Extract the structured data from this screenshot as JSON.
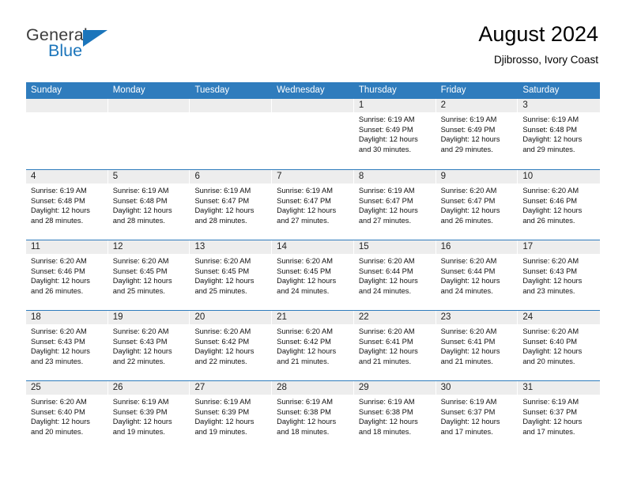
{
  "logo": {
    "word_top": "General",
    "word_bottom": "Blue",
    "accent_color": "#1b75bb",
    "text_color": "#3c3c3c",
    "triangle_icon": "triangle-icon"
  },
  "header": {
    "title": "August 2024",
    "subtitle": "Djibrosso, Ivory Coast"
  },
  "colors": {
    "header_blue": "#2f7cbd",
    "day_strip_gray": "#ededed",
    "text": "#000000"
  },
  "weekdays": [
    "Sunday",
    "Monday",
    "Tuesday",
    "Wednesday",
    "Thursday",
    "Friday",
    "Saturday"
  ],
  "weeks": [
    [
      {
        "day": "",
        "empty": true
      },
      {
        "day": "",
        "empty": true
      },
      {
        "day": "",
        "empty": true
      },
      {
        "day": "",
        "empty": true
      },
      {
        "day": "1",
        "sunrise": "Sunrise: 6:19 AM",
        "sunset": "Sunset: 6:49 PM",
        "daylight_1": "Daylight: 12 hours",
        "daylight_2": "and 30 minutes."
      },
      {
        "day": "2",
        "sunrise": "Sunrise: 6:19 AM",
        "sunset": "Sunset: 6:49 PM",
        "daylight_1": "Daylight: 12 hours",
        "daylight_2": "and 29 minutes."
      },
      {
        "day": "3",
        "sunrise": "Sunrise: 6:19 AM",
        "sunset": "Sunset: 6:48 PM",
        "daylight_1": "Daylight: 12 hours",
        "daylight_2": "and 29 minutes."
      }
    ],
    [
      {
        "day": "4",
        "sunrise": "Sunrise: 6:19 AM",
        "sunset": "Sunset: 6:48 PM",
        "daylight_1": "Daylight: 12 hours",
        "daylight_2": "and 28 minutes."
      },
      {
        "day": "5",
        "sunrise": "Sunrise: 6:19 AM",
        "sunset": "Sunset: 6:48 PM",
        "daylight_1": "Daylight: 12 hours",
        "daylight_2": "and 28 minutes."
      },
      {
        "day": "6",
        "sunrise": "Sunrise: 6:19 AM",
        "sunset": "Sunset: 6:47 PM",
        "daylight_1": "Daylight: 12 hours",
        "daylight_2": "and 28 minutes."
      },
      {
        "day": "7",
        "sunrise": "Sunrise: 6:19 AM",
        "sunset": "Sunset: 6:47 PM",
        "daylight_1": "Daylight: 12 hours",
        "daylight_2": "and 27 minutes."
      },
      {
        "day": "8",
        "sunrise": "Sunrise: 6:19 AM",
        "sunset": "Sunset: 6:47 PM",
        "daylight_1": "Daylight: 12 hours",
        "daylight_2": "and 27 minutes."
      },
      {
        "day": "9",
        "sunrise": "Sunrise: 6:20 AM",
        "sunset": "Sunset: 6:47 PM",
        "daylight_1": "Daylight: 12 hours",
        "daylight_2": "and 26 minutes."
      },
      {
        "day": "10",
        "sunrise": "Sunrise: 6:20 AM",
        "sunset": "Sunset: 6:46 PM",
        "daylight_1": "Daylight: 12 hours",
        "daylight_2": "and 26 minutes."
      }
    ],
    [
      {
        "day": "11",
        "sunrise": "Sunrise: 6:20 AM",
        "sunset": "Sunset: 6:46 PM",
        "daylight_1": "Daylight: 12 hours",
        "daylight_2": "and 26 minutes."
      },
      {
        "day": "12",
        "sunrise": "Sunrise: 6:20 AM",
        "sunset": "Sunset: 6:45 PM",
        "daylight_1": "Daylight: 12 hours",
        "daylight_2": "and 25 minutes."
      },
      {
        "day": "13",
        "sunrise": "Sunrise: 6:20 AM",
        "sunset": "Sunset: 6:45 PM",
        "daylight_1": "Daylight: 12 hours",
        "daylight_2": "and 25 minutes."
      },
      {
        "day": "14",
        "sunrise": "Sunrise: 6:20 AM",
        "sunset": "Sunset: 6:45 PM",
        "daylight_1": "Daylight: 12 hours",
        "daylight_2": "and 24 minutes."
      },
      {
        "day": "15",
        "sunrise": "Sunrise: 6:20 AM",
        "sunset": "Sunset: 6:44 PM",
        "daylight_1": "Daylight: 12 hours",
        "daylight_2": "and 24 minutes."
      },
      {
        "day": "16",
        "sunrise": "Sunrise: 6:20 AM",
        "sunset": "Sunset: 6:44 PM",
        "daylight_1": "Daylight: 12 hours",
        "daylight_2": "and 24 minutes."
      },
      {
        "day": "17",
        "sunrise": "Sunrise: 6:20 AM",
        "sunset": "Sunset: 6:43 PM",
        "daylight_1": "Daylight: 12 hours",
        "daylight_2": "and 23 minutes."
      }
    ],
    [
      {
        "day": "18",
        "sunrise": "Sunrise: 6:20 AM",
        "sunset": "Sunset: 6:43 PM",
        "daylight_1": "Daylight: 12 hours",
        "daylight_2": "and 23 minutes."
      },
      {
        "day": "19",
        "sunrise": "Sunrise: 6:20 AM",
        "sunset": "Sunset: 6:43 PM",
        "daylight_1": "Daylight: 12 hours",
        "daylight_2": "and 22 minutes."
      },
      {
        "day": "20",
        "sunrise": "Sunrise: 6:20 AM",
        "sunset": "Sunset: 6:42 PM",
        "daylight_1": "Daylight: 12 hours",
        "daylight_2": "and 22 minutes."
      },
      {
        "day": "21",
        "sunrise": "Sunrise: 6:20 AM",
        "sunset": "Sunset: 6:42 PM",
        "daylight_1": "Daylight: 12 hours",
        "daylight_2": "and 21 minutes."
      },
      {
        "day": "22",
        "sunrise": "Sunrise: 6:20 AM",
        "sunset": "Sunset: 6:41 PM",
        "daylight_1": "Daylight: 12 hours",
        "daylight_2": "and 21 minutes."
      },
      {
        "day": "23",
        "sunrise": "Sunrise: 6:20 AM",
        "sunset": "Sunset: 6:41 PM",
        "daylight_1": "Daylight: 12 hours",
        "daylight_2": "and 21 minutes."
      },
      {
        "day": "24",
        "sunrise": "Sunrise: 6:20 AM",
        "sunset": "Sunset: 6:40 PM",
        "daylight_1": "Daylight: 12 hours",
        "daylight_2": "and 20 minutes."
      }
    ],
    [
      {
        "day": "25",
        "sunrise": "Sunrise: 6:20 AM",
        "sunset": "Sunset: 6:40 PM",
        "daylight_1": "Daylight: 12 hours",
        "daylight_2": "and 20 minutes."
      },
      {
        "day": "26",
        "sunrise": "Sunrise: 6:19 AM",
        "sunset": "Sunset: 6:39 PM",
        "daylight_1": "Daylight: 12 hours",
        "daylight_2": "and 19 minutes."
      },
      {
        "day": "27",
        "sunrise": "Sunrise: 6:19 AM",
        "sunset": "Sunset: 6:39 PM",
        "daylight_1": "Daylight: 12 hours",
        "daylight_2": "and 19 minutes."
      },
      {
        "day": "28",
        "sunrise": "Sunrise: 6:19 AM",
        "sunset": "Sunset: 6:38 PM",
        "daylight_1": "Daylight: 12 hours",
        "daylight_2": "and 18 minutes."
      },
      {
        "day": "29",
        "sunrise": "Sunrise: 6:19 AM",
        "sunset": "Sunset: 6:38 PM",
        "daylight_1": "Daylight: 12 hours",
        "daylight_2": "and 18 minutes."
      },
      {
        "day": "30",
        "sunrise": "Sunrise: 6:19 AM",
        "sunset": "Sunset: 6:37 PM",
        "daylight_1": "Daylight: 12 hours",
        "daylight_2": "and 17 minutes."
      },
      {
        "day": "31",
        "sunrise": "Sunrise: 6:19 AM",
        "sunset": "Sunset: 6:37 PM",
        "daylight_1": "Daylight: 12 hours",
        "daylight_2": "and 17 minutes."
      }
    ]
  ]
}
